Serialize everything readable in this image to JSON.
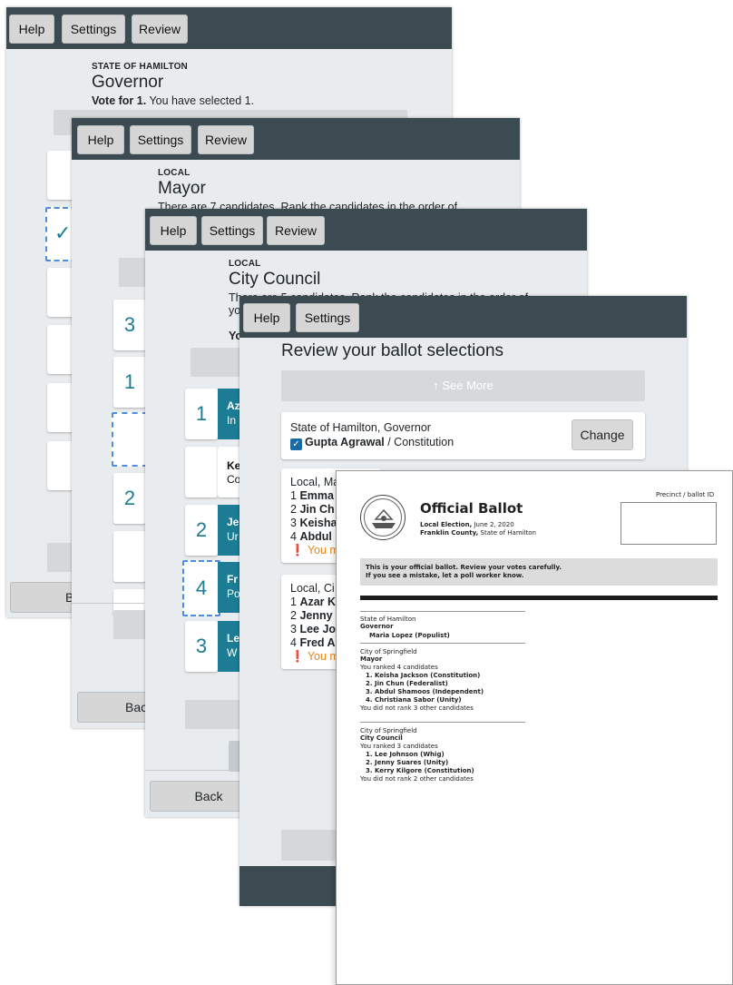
{
  "toolbar": {
    "help": "Help",
    "settings": "Settings",
    "review": "Review",
    "back": "Back",
    "back_partial": "Bac",
    "back_partial2": "Back"
  },
  "governor_screen": {
    "category": "STATE OF HAMILTON",
    "title": "Governor",
    "instructions_bold": "Vote for 1.",
    "instructions_rest": " You have selected 1.",
    "check_glyph": "✓"
  },
  "mayor_screen": {
    "category": "LOCAL",
    "title": "Mayor",
    "instructions": "There are 7 candidates. Rank the candidates in the order of",
    "ranks": [
      "3",
      "1",
      "",
      "2",
      "",
      ""
    ]
  },
  "council_screen": {
    "category": "LOCAL",
    "title": "City Council",
    "instructions": "There are 5 candidates. Rank the candidates in the order of",
    "instructions2": "yo",
    "instructions3": "Yo",
    "ranks": [
      "1",
      "",
      "2",
      "4",
      "3"
    ],
    "cards": [
      {
        "name": "Az",
        "party": "In"
      },
      {
        "name": "Ke",
        "party": "Co"
      },
      {
        "name": "Je",
        "party": "Ur"
      },
      {
        "name": "Fr",
        "party": "Po"
      },
      {
        "name": "Le",
        "party": "W"
      }
    ]
  },
  "review_screen": {
    "title": "Review your ballot selections",
    "see_more": "↑ See More",
    "governor_contest": "State of Hamilton, Governor",
    "governor_choice": "Gupta Agrawal",
    "governor_party": " / Constitution",
    "change": "Change",
    "mayor_contest": "Local, Ma",
    "mayor_lines": [
      {
        "rank": "1",
        "name": "Emma"
      },
      {
        "rank": "2",
        "name": "Jin Ch"
      },
      {
        "rank": "3",
        "name": "Keisha"
      },
      {
        "rank": "4",
        "name": "Abdul"
      }
    ],
    "mayor_warning": "You m",
    "council_contest": "Local, Ci",
    "council_lines": [
      {
        "rank": "1",
        "name": "Azar K"
      },
      {
        "rank": "2",
        "name": "Jenny"
      },
      {
        "rank": "3",
        "name": "Lee Jo"
      },
      {
        "rank": "4",
        "name": "Fred A"
      }
    ],
    "council_warning": "You m"
  },
  "paper_ballot": {
    "title": "Official Ballot",
    "election_bold": "Local Election,",
    "election_date": " June 2, 2020",
    "county_bold": "Franklin County,",
    "county_rest": " State of Hamilton",
    "precinct_label": "Precinct / ballot ID",
    "notice_line1": "This is your official ballot. Review your votes carefully.",
    "notice_line2": "If you see a mistake, let a poll worker know.",
    "sections": {
      "gov_juris": "State of Hamilton",
      "gov_office": "Governor",
      "gov_choice": "Maria Lopez (Populist)",
      "mayor_juris": "City of Springfield",
      "mayor_office": "Mayor",
      "mayor_ranked": "You ranked 4 candidates",
      "mayor_list": [
        "1.  Keisha Jackson (Constitution)",
        "2.  Jin Chun (Federalist)",
        "3.  Abdul Shamoos (Independent)",
        "4.  Christiana Sabor (Unity)"
      ],
      "mayor_unranked": "You did not rank 3 other candidates",
      "council_juris": "City of Springfield",
      "council_office": "City Council",
      "council_ranked": "You ranked 3 candidates",
      "council_list": [
        "1.  Lee Johnson (Whig)",
        "2.  Jenny Suares (Unity)",
        "3.  Kerry Kilgore (Constitution)"
      ],
      "council_unranked": "You did not rank 2 other candidates"
    }
  }
}
